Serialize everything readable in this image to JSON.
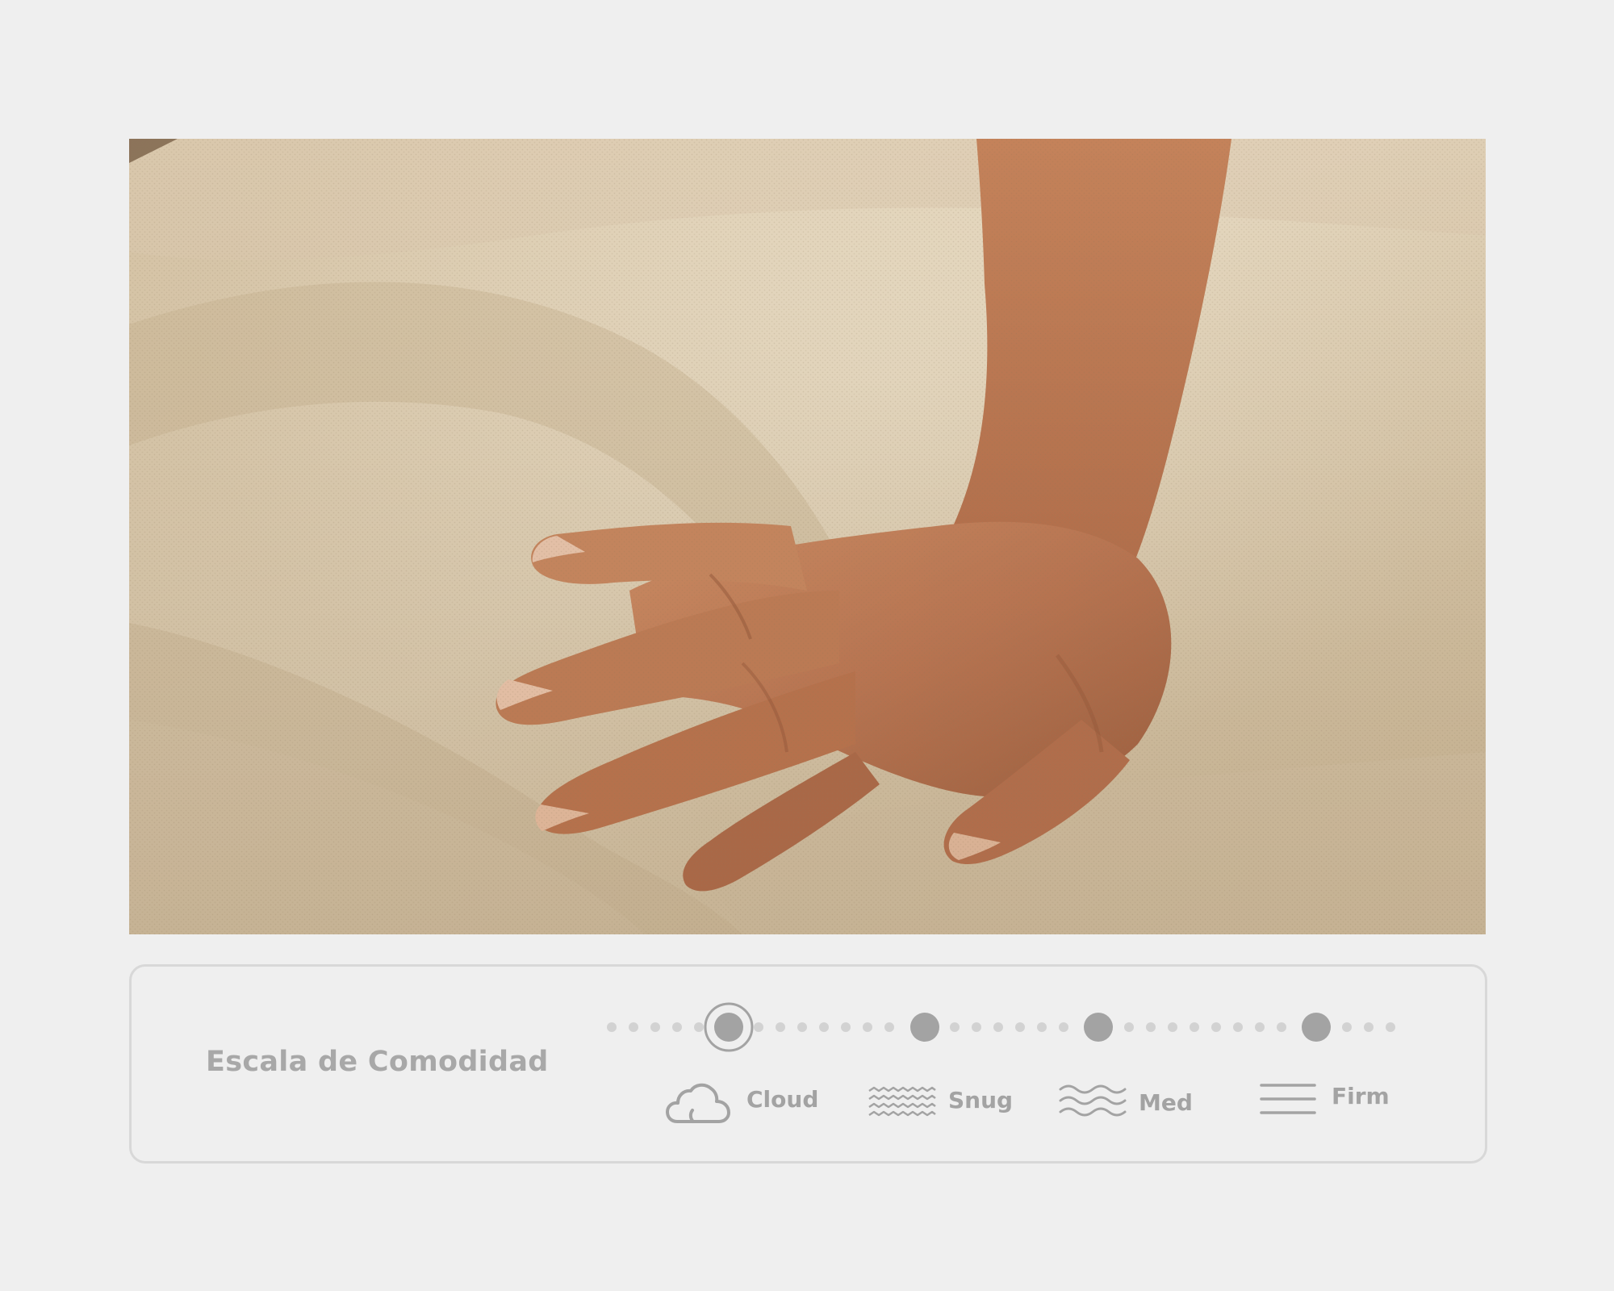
{
  "comfort_scale": {
    "title": "Escala de Comodidad",
    "levels": [
      {
        "label": "Cloud",
        "icon": "cloud-icon",
        "selected": true
      },
      {
        "label": "Snug",
        "icon": "zigzag-waves-icon",
        "selected": false
      },
      {
        "label": "Med",
        "icon": "waves-icon",
        "selected": false
      },
      {
        "label": "Firm",
        "icon": "lines-icon",
        "selected": false
      }
    ]
  },
  "colors": {
    "background": "#efefef",
    "accent_gray": "#a3a3a3",
    "card_border": "#d8d8d8"
  }
}
